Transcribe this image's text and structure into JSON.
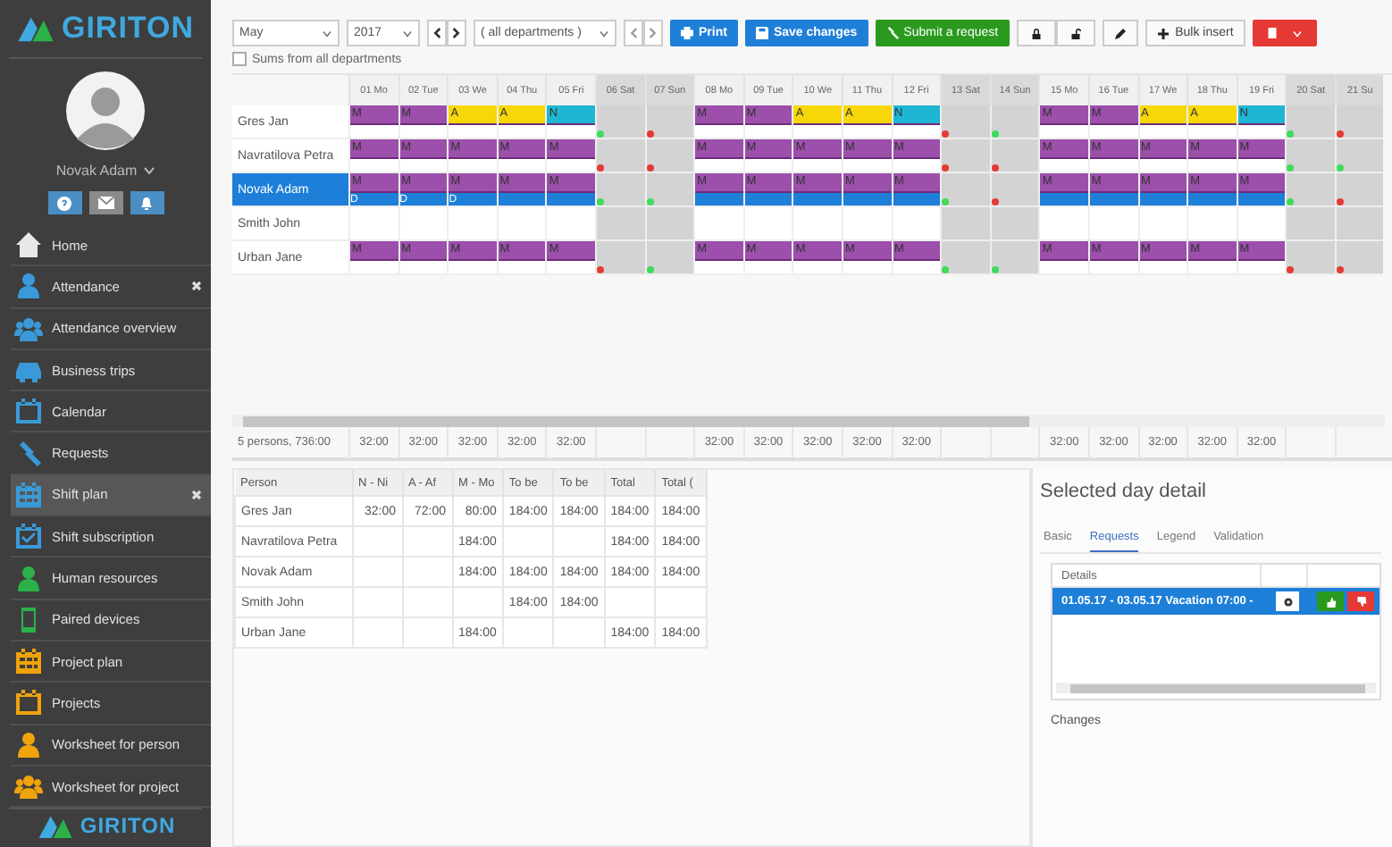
{
  "sidebar": {
    "logo": "GIRITON",
    "user": "Novak Adam",
    "items": [
      {
        "label": "Home",
        "color": "#e8e8e8",
        "selected": false,
        "closable": false
      },
      {
        "label": "Attendance",
        "color": "#3a9ad9",
        "selected": false,
        "closable": true
      },
      {
        "label": "Attendance overview",
        "color": "#3a9ad9",
        "selected": false,
        "closable": false
      },
      {
        "label": "Business trips",
        "color": "#3a9ad9",
        "selected": false,
        "closable": false
      },
      {
        "label": "Calendar",
        "color": "#3a9ad9",
        "selected": false,
        "closable": false
      },
      {
        "label": "Requests",
        "color": "#3a9ad9",
        "selected": false,
        "closable": false
      },
      {
        "label": "Shift plan",
        "color": "#3a9ad9",
        "selected": true,
        "closable": true
      },
      {
        "label": "Shift subscription",
        "color": "#3a9ad9",
        "selected": false,
        "closable": false
      },
      {
        "label": "Human resources",
        "color": "#2bb04a",
        "selected": false,
        "closable": false
      },
      {
        "label": "Paired devices",
        "color": "#2bb04a",
        "selected": false,
        "closable": false
      },
      {
        "label": "Project plan",
        "color": "#f0a30a",
        "selected": false,
        "closable": false
      },
      {
        "label": "Projects",
        "color": "#f0a30a",
        "selected": false,
        "closable": false
      },
      {
        "label": "Worksheet for person",
        "color": "#f0a30a",
        "selected": false,
        "closable": false
      },
      {
        "label": "Worksheet for project",
        "color": "#f0a30a",
        "selected": false,
        "closable": false
      }
    ],
    "footer_logo": "GIRITON"
  },
  "toolbar": {
    "month": "May",
    "year": "2017",
    "department": "( all departments )",
    "print": "Print",
    "save": "Save changes",
    "submit": "Submit a request",
    "bulk": "Bulk insert",
    "sums_checkbox": {
      "label": "Sums from all departments",
      "checked": false
    }
  },
  "plan": {
    "days": [
      {
        "label": "01 Mo",
        "weekend": false,
        "total": "32:00"
      },
      {
        "label": "02 Tue",
        "weekend": false,
        "total": "32:00"
      },
      {
        "label": "03 We",
        "weekend": false,
        "total": "32:00"
      },
      {
        "label": "04 Thu",
        "weekend": false,
        "total": "32:00"
      },
      {
        "label": "05 Fri",
        "weekend": false,
        "total": "32:00"
      },
      {
        "label": "06 Sat",
        "weekend": true
      },
      {
        "label": "07 Sun",
        "weekend": true
      },
      {
        "label": "08 Mo",
        "weekend": false,
        "total": "32:00"
      },
      {
        "label": "09 Tue",
        "weekend": false,
        "total": "32:00"
      },
      {
        "label": "10 We",
        "weekend": false,
        "total": "32:00"
      },
      {
        "label": "11 Thu",
        "weekend": false,
        "total": "32:00"
      },
      {
        "label": "12 Fri",
        "weekend": false,
        "total": "32:00"
      },
      {
        "label": "13 Sat",
        "weekend": true
      },
      {
        "label": "14 Sun",
        "weekend": true
      },
      {
        "label": "15 Mo",
        "weekend": false,
        "total": "32:00"
      },
      {
        "label": "16 Tue",
        "weekend": false,
        "total": "32:00"
      },
      {
        "label": "17 We",
        "weekend": false,
        "total": "32:00"
      },
      {
        "label": "18 Thu",
        "weekend": false,
        "total": "32:00"
      },
      {
        "label": "19 Fri",
        "weekend": false,
        "total": "32:00"
      },
      {
        "label": "20 Sat",
        "weekend": true
      },
      {
        "label": "21 Su",
        "weekend": true
      }
    ],
    "rows": [
      {
        "name": "Gres Jan",
        "selected": false,
        "cells": [
          {
            "shift": "M"
          },
          {
            "shift": "M"
          },
          {
            "shift": "A"
          },
          {
            "shift": "A"
          },
          {
            "shift": "N"
          },
          {
            "color": "#3ddc5a"
          },
          {
            "color": "#e53935"
          },
          {
            "shift": "M"
          },
          {
            "shift": "M"
          },
          {
            "shift": "A"
          },
          {
            "shift": "A"
          },
          {
            "shift": "N"
          },
          {
            "color": "#e53935"
          },
          {
            "color": "#3ddc5a"
          },
          {
            "shift": "M"
          },
          {
            "shift": "M"
          },
          {
            "shift": "A"
          },
          {
            "shift": "A"
          },
          {
            "shift": "N"
          },
          {
            "color": "#3ddc5a"
          },
          {
            "color": "#e53935"
          }
        ]
      },
      {
        "name": "Navratilova Petra",
        "selected": false,
        "cells": [
          {
            "shift": "M"
          },
          {
            "shift": "M"
          },
          {
            "shift": "M"
          },
          {
            "shift": "M"
          },
          {
            "shift": "M"
          },
          {
            "color": "#e53935"
          },
          {
            "color": "#e53935"
          },
          {
            "shift": "M"
          },
          {
            "shift": "M"
          },
          {
            "shift": "M"
          },
          {
            "shift": "M"
          },
          {
            "shift": "M"
          },
          {
            "color": "#e53935"
          },
          {
            "color": "#e53935"
          },
          {
            "shift": "M"
          },
          {
            "shift": "M"
          },
          {
            "shift": "M"
          },
          {
            "shift": "M"
          },
          {
            "shift": "M"
          },
          {
            "color": "#3ddc5a"
          },
          {
            "color": "#3ddc5a"
          }
        ]
      },
      {
        "name": "Novak Adam",
        "selected": true,
        "cells": [
          {
            "shift": "M",
            "note": "D"
          },
          {
            "shift": "M",
            "note": "D"
          },
          {
            "shift": "M",
            "note": "D"
          },
          {
            "shift": "M"
          },
          {
            "shift": "M"
          },
          {
            "color": "#3ddc5a"
          },
          {
            "color": "#3ddc5a"
          },
          {
            "shift": "M"
          },
          {
            "shift": "M"
          },
          {
            "shift": "M"
          },
          {
            "shift": "M"
          },
          {
            "shift": "M"
          },
          {
            "color": "#3ddc5a"
          },
          {
            "color": "#e53935"
          },
          {
            "shift": "M"
          },
          {
            "shift": "M"
          },
          {
            "shift": "M"
          },
          {
            "shift": "M"
          },
          {
            "shift": "M"
          },
          {
            "color": "#3ddc5a"
          },
          {
            "color": "#e53935"
          }
        ]
      },
      {
        "name": "Smith John",
        "selected": false,
        "cells": [
          {},
          {},
          {},
          {},
          {},
          {},
          {},
          {},
          {},
          {},
          {},
          {},
          {},
          {},
          {},
          {},
          {},
          {},
          {},
          {},
          {}
        ]
      },
      {
        "name": "Urban Jane",
        "selected": false,
        "cells": [
          {
            "shift": "M"
          },
          {
            "shift": "M"
          },
          {
            "shift": "M"
          },
          {
            "shift": "M"
          },
          {
            "shift": "M"
          },
          {
            "color": "#e53935"
          },
          {
            "color": "#3ddc5a"
          },
          {
            "shift": "M"
          },
          {
            "shift": "M"
          },
          {
            "shift": "M"
          },
          {
            "shift": "M"
          },
          {
            "shift": "M"
          },
          {
            "color": "#3ddc5a"
          },
          {
            "color": "#3ddc5a"
          },
          {
            "shift": "M"
          },
          {
            "shift": "M"
          },
          {
            "shift": "M"
          },
          {
            "shift": "M"
          },
          {
            "shift": "M"
          },
          {
            "color": "#e53935"
          },
          {
            "color": "#e53935"
          }
        ]
      }
    ],
    "totals_label": "5 persons, 736:00"
  },
  "summary": {
    "columns": [
      "Person",
      "N - Ni",
      "A - Af",
      "M - Mo",
      "To be",
      "To be",
      "Total",
      "Total ("
    ],
    "rows": [
      {
        "cells": [
          {
            "text": "Gres Jan"
          },
          {
            "text": "32:00"
          },
          {
            "text": "72:00"
          },
          {
            "text": "80:00"
          },
          {
            "text": "184:00"
          },
          {
            "text": "184:00"
          },
          {
            "text": "184:00"
          },
          {
            "text": "184:00"
          }
        ]
      },
      {
        "cells": [
          {
            "text": "Navratilova Petra"
          },
          {},
          {},
          {
            "text": "184:00"
          },
          {},
          {},
          {
            "text": "184:00"
          },
          {
            "text": "184:00"
          }
        ]
      },
      {
        "cells": [
          {
            "text": "Novak Adam"
          },
          {},
          {},
          {
            "text": "184:00"
          },
          {
            "text": "184:00"
          },
          {
            "text": "184:00"
          },
          {
            "text": "184:00"
          },
          {
            "text": "184:00"
          }
        ]
      },
      {
        "cells": [
          {
            "text": "Smith John"
          },
          {},
          {},
          {},
          {
            "text": "184:00"
          },
          {
            "text": "184:00"
          },
          {},
          {}
        ]
      },
      {
        "cells": [
          {
            "text": "Urban Jane"
          },
          {},
          {},
          {
            "text": "184:00"
          },
          {},
          {},
          {
            "text": "184:00"
          },
          {
            "text": "184:00"
          }
        ]
      }
    ]
  },
  "detail": {
    "title": "Selected day detail",
    "tabs": [
      {
        "label": "Basic",
        "selected": false
      },
      {
        "label": "Requests",
        "selected": true
      },
      {
        "label": "Legend",
        "selected": false
      },
      {
        "label": "Validation",
        "selected": false
      }
    ],
    "column": "Details",
    "requests": [
      {
        "text": "01.05.17 - 03.05.17 Vacation 07:00 -",
        "selected": true
      }
    ],
    "changes": "Changes"
  }
}
